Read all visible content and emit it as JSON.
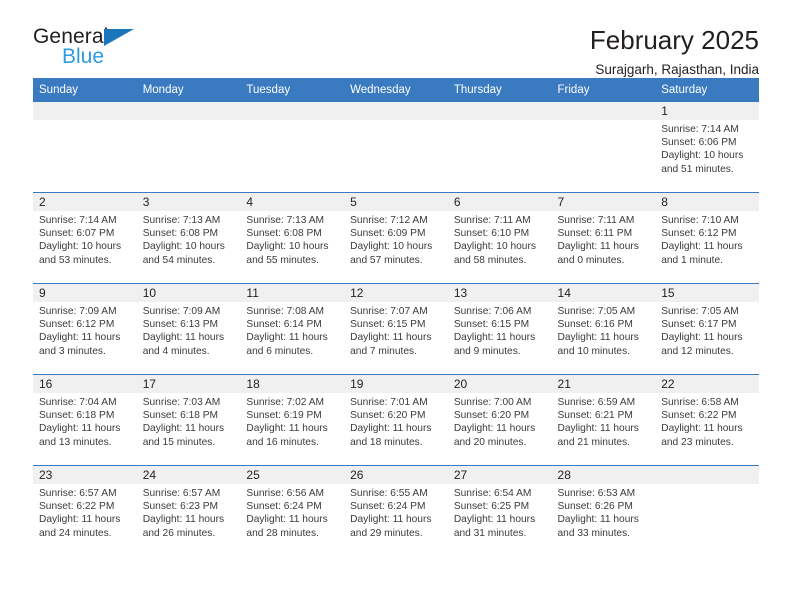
{
  "brand": {
    "name_part1": "General",
    "name_part2": "Blue",
    "triangle_color": "#1b75bb",
    "blue_text_color": "#2e9bdf"
  },
  "header": {
    "title": "February 2025",
    "subtitle": "Surajgarh, Rajasthan, India",
    "header_bg_color": "#3a7ac0",
    "daynum_band_color": "#f0f0f0"
  },
  "weekday_headers": [
    "Sunday",
    "Monday",
    "Tuesday",
    "Wednesday",
    "Thursday",
    "Friday",
    "Saturday"
  ],
  "labels": {
    "sunrise": "Sunrise:",
    "sunset": "Sunset:",
    "daylight": "Daylight:"
  },
  "weeks": [
    [
      {
        "day": ""
      },
      {
        "day": ""
      },
      {
        "day": ""
      },
      {
        "day": ""
      },
      {
        "day": ""
      },
      {
        "day": ""
      },
      {
        "day": "1",
        "sunrise": "Sunrise: 7:14 AM",
        "sunset": "Sunset: 6:06 PM",
        "daylight": "Daylight: 10 hours and 51 minutes."
      }
    ],
    [
      {
        "day": "2",
        "sunrise": "Sunrise: 7:14 AM",
        "sunset": "Sunset: 6:07 PM",
        "daylight": "Daylight: 10 hours and 53 minutes."
      },
      {
        "day": "3",
        "sunrise": "Sunrise: 7:13 AM",
        "sunset": "Sunset: 6:08 PM",
        "daylight": "Daylight: 10 hours and 54 minutes."
      },
      {
        "day": "4",
        "sunrise": "Sunrise: 7:13 AM",
        "sunset": "Sunset: 6:08 PM",
        "daylight": "Daylight: 10 hours and 55 minutes."
      },
      {
        "day": "5",
        "sunrise": "Sunrise: 7:12 AM",
        "sunset": "Sunset: 6:09 PM",
        "daylight": "Daylight: 10 hours and 57 minutes."
      },
      {
        "day": "6",
        "sunrise": "Sunrise: 7:11 AM",
        "sunset": "Sunset: 6:10 PM",
        "daylight": "Daylight: 10 hours and 58 minutes."
      },
      {
        "day": "7",
        "sunrise": "Sunrise: 7:11 AM",
        "sunset": "Sunset: 6:11 PM",
        "daylight": "Daylight: 11 hours and 0 minutes."
      },
      {
        "day": "8",
        "sunrise": "Sunrise: 7:10 AM",
        "sunset": "Sunset: 6:12 PM",
        "daylight": "Daylight: 11 hours and 1 minute."
      }
    ],
    [
      {
        "day": "9",
        "sunrise": "Sunrise: 7:09 AM",
        "sunset": "Sunset: 6:12 PM",
        "daylight": "Daylight: 11 hours and 3 minutes."
      },
      {
        "day": "10",
        "sunrise": "Sunrise: 7:09 AM",
        "sunset": "Sunset: 6:13 PM",
        "daylight": "Daylight: 11 hours and 4 minutes."
      },
      {
        "day": "11",
        "sunrise": "Sunrise: 7:08 AM",
        "sunset": "Sunset: 6:14 PM",
        "daylight": "Daylight: 11 hours and 6 minutes."
      },
      {
        "day": "12",
        "sunrise": "Sunrise: 7:07 AM",
        "sunset": "Sunset: 6:15 PM",
        "daylight": "Daylight: 11 hours and 7 minutes."
      },
      {
        "day": "13",
        "sunrise": "Sunrise: 7:06 AM",
        "sunset": "Sunset: 6:15 PM",
        "daylight": "Daylight: 11 hours and 9 minutes."
      },
      {
        "day": "14",
        "sunrise": "Sunrise: 7:05 AM",
        "sunset": "Sunset: 6:16 PM",
        "daylight": "Daylight: 11 hours and 10 minutes."
      },
      {
        "day": "15",
        "sunrise": "Sunrise: 7:05 AM",
        "sunset": "Sunset: 6:17 PM",
        "daylight": "Daylight: 11 hours and 12 minutes."
      }
    ],
    [
      {
        "day": "16",
        "sunrise": "Sunrise: 7:04 AM",
        "sunset": "Sunset: 6:18 PM",
        "daylight": "Daylight: 11 hours and 13 minutes."
      },
      {
        "day": "17",
        "sunrise": "Sunrise: 7:03 AM",
        "sunset": "Sunset: 6:18 PM",
        "daylight": "Daylight: 11 hours and 15 minutes."
      },
      {
        "day": "18",
        "sunrise": "Sunrise: 7:02 AM",
        "sunset": "Sunset: 6:19 PM",
        "daylight": "Daylight: 11 hours and 16 minutes."
      },
      {
        "day": "19",
        "sunrise": "Sunrise: 7:01 AM",
        "sunset": "Sunset: 6:20 PM",
        "daylight": "Daylight: 11 hours and 18 minutes."
      },
      {
        "day": "20",
        "sunrise": "Sunrise: 7:00 AM",
        "sunset": "Sunset: 6:20 PM",
        "daylight": "Daylight: 11 hours and 20 minutes."
      },
      {
        "day": "21",
        "sunrise": "Sunrise: 6:59 AM",
        "sunset": "Sunset: 6:21 PM",
        "daylight": "Daylight: 11 hours and 21 minutes."
      },
      {
        "day": "22",
        "sunrise": "Sunrise: 6:58 AM",
        "sunset": "Sunset: 6:22 PM",
        "daylight": "Daylight: 11 hours and 23 minutes."
      }
    ],
    [
      {
        "day": "23",
        "sunrise": "Sunrise: 6:57 AM",
        "sunset": "Sunset: 6:22 PM",
        "daylight": "Daylight: 11 hours and 24 minutes."
      },
      {
        "day": "24",
        "sunrise": "Sunrise: 6:57 AM",
        "sunset": "Sunset: 6:23 PM",
        "daylight": "Daylight: 11 hours and 26 minutes."
      },
      {
        "day": "25",
        "sunrise": "Sunrise: 6:56 AM",
        "sunset": "Sunset: 6:24 PM",
        "daylight": "Daylight: 11 hours and 28 minutes."
      },
      {
        "day": "26",
        "sunrise": "Sunrise: 6:55 AM",
        "sunset": "Sunset: 6:24 PM",
        "daylight": "Daylight: 11 hours and 29 minutes."
      },
      {
        "day": "27",
        "sunrise": "Sunrise: 6:54 AM",
        "sunset": "Sunset: 6:25 PM",
        "daylight": "Daylight: 11 hours and 31 minutes."
      },
      {
        "day": "28",
        "sunrise": "Sunrise: 6:53 AM",
        "sunset": "Sunset: 6:26 PM",
        "daylight": "Daylight: 11 hours and 33 minutes."
      },
      {
        "day": ""
      }
    ]
  ]
}
